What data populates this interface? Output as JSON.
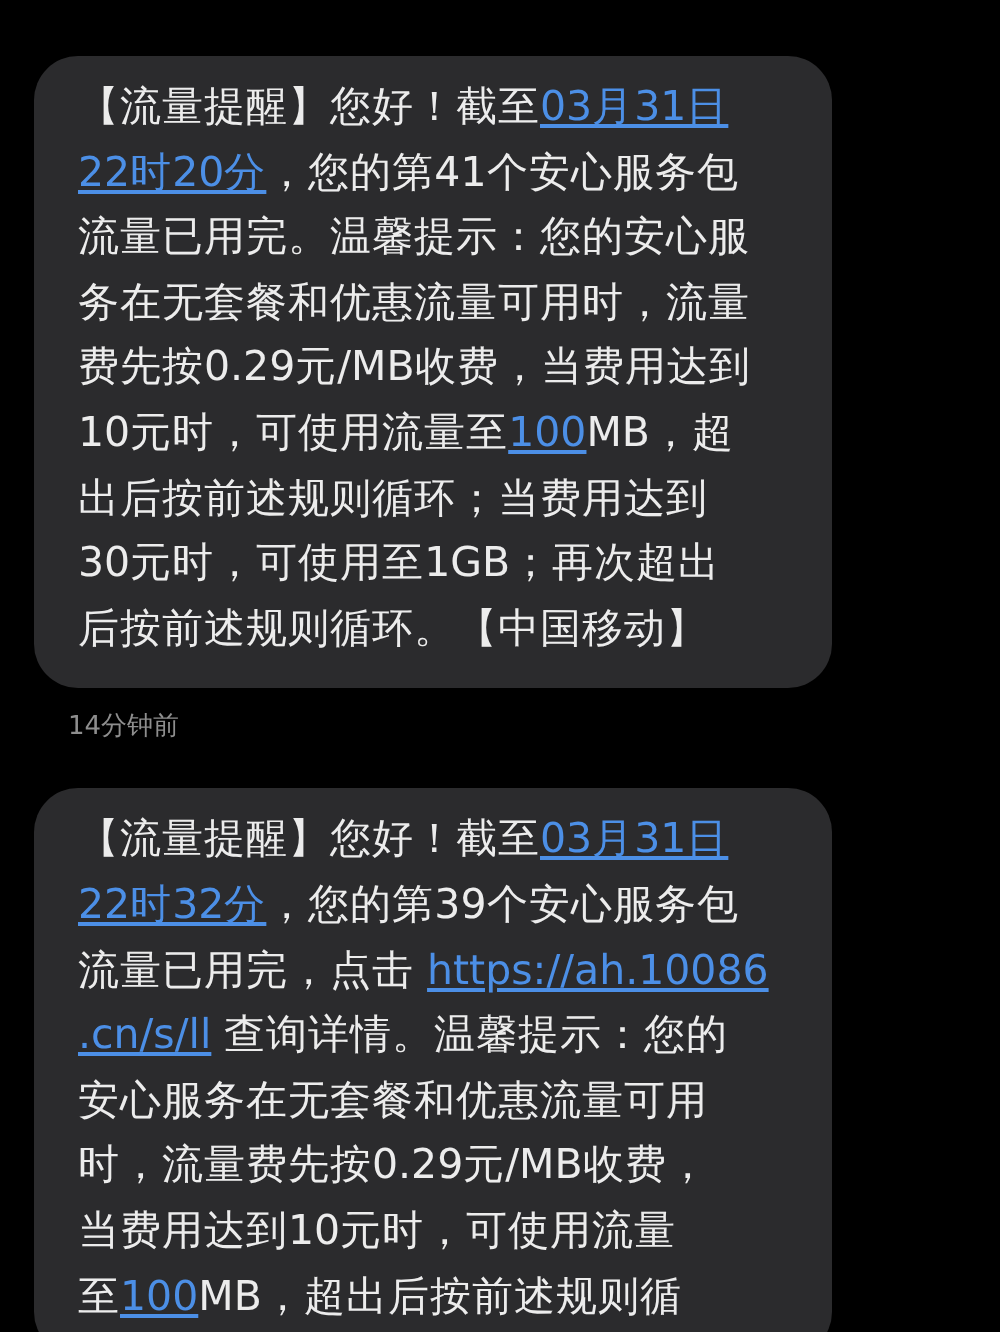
{
  "messages": [
    {
      "lines": [
        [
          {
            "kind": "text",
            "text": "【流量提醒】您好！截至"
          },
          {
            "kind": "link",
            "text": "03月31日"
          }
        ],
        [
          {
            "kind": "link",
            "text": "22时20分"
          },
          {
            "kind": "text",
            "text": "，您的第41个安心服务包"
          }
        ],
        [
          {
            "kind": "text",
            "text": "流量已用完。温馨提示：您的安心服"
          }
        ],
        [
          {
            "kind": "text",
            "text": "务在无套餐和优惠流量可用时，流量"
          }
        ],
        [
          {
            "kind": "text",
            "text": "费先按0.29元/MB收费，当费用达到"
          }
        ],
        [
          {
            "kind": "text",
            "text": "10元时，可使用流量至"
          },
          {
            "kind": "link",
            "text": "100"
          },
          {
            "kind": "text",
            "text": "MB，超"
          }
        ],
        [
          {
            "kind": "text",
            "text": "出后按前述规则循环；当费用达到"
          }
        ],
        [
          {
            "kind": "text",
            "text": "30元时，可使用至1GB；再次超出"
          }
        ],
        [
          {
            "kind": "text",
            "text": "后按前述规则循环。【中国移动】"
          }
        ]
      ],
      "time": "14分钟前"
    },
    {
      "lines": [
        [
          {
            "kind": "text",
            "text": "【流量提醒】您好！截至"
          },
          {
            "kind": "link",
            "text": "03月31日"
          }
        ],
        [
          {
            "kind": "link",
            "text": "22时32分"
          },
          {
            "kind": "text",
            "text": "，您的第39个安心服务包"
          }
        ],
        [
          {
            "kind": "text",
            "text": "流量已用完，点击 "
          },
          {
            "kind": "link",
            "text": "https://ah.10086"
          }
        ],
        [
          {
            "kind": "link",
            "text": ".cn/s/ll"
          },
          {
            "kind": "text",
            "text": " 查询详情。温馨提示：您的"
          }
        ],
        [
          {
            "kind": "text",
            "text": "安心服务在无套餐和优惠流量可用"
          }
        ],
        [
          {
            "kind": "text",
            "text": "时，流量费先按0.29元/MB收费，"
          }
        ],
        [
          {
            "kind": "text",
            "text": "当费用达到10元时，可使用流量"
          }
        ],
        [
          {
            "kind": "text",
            "text": "至"
          },
          {
            "kind": "link",
            "text": "100"
          },
          {
            "kind": "text",
            "text": "MB，超出后按前述规则循"
          }
        ]
      ]
    }
  ]
}
